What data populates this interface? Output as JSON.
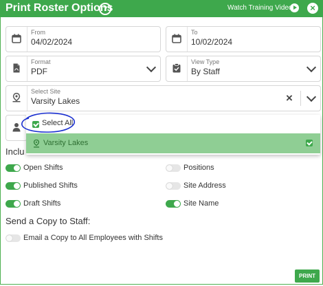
{
  "header": {
    "title": "Print Roster Options",
    "help_icon": "?",
    "watch_label": "Watch Training Video",
    "close_icon": "×",
    "color": "#3ea84c"
  },
  "fields": {
    "from": {
      "label": "From",
      "value": "04/02/2024",
      "icon": "calendar-icon"
    },
    "to": {
      "label": "To",
      "value": "10/02/2024",
      "icon": "calendar-icon"
    },
    "format": {
      "label": "Format",
      "value": "PDF",
      "icon": "pdf-file-icon"
    },
    "view_type": {
      "label": "View Type",
      "value": "By Staff",
      "icon": "clipboard-check-icon"
    },
    "site": {
      "label": "Select Site",
      "value": "Varsity Lakes",
      "icon": "map-pin-icon",
      "clear_icon": "×"
    }
  },
  "dropdown": {
    "select_all": "Select All",
    "items": [
      {
        "label": "Varsity Lakes",
        "selected": true,
        "highlight": "#8fce94"
      }
    ]
  },
  "include": {
    "title_visible": "Inclu",
    "left": [
      {
        "label": "Open Shifts",
        "on": true
      },
      {
        "label": "Published Shifts",
        "on": true
      },
      {
        "label": "Draft Shifts",
        "on": true
      }
    ],
    "right": [
      {
        "label": "Positions",
        "on": false
      },
      {
        "label": "Site Address",
        "on": false
      },
      {
        "label": "Site Name",
        "on": true
      }
    ]
  },
  "copy_section": {
    "title": "Send a Copy to Staff:",
    "option": {
      "label": "Email a Copy to All Employees with Shifts",
      "on": false
    }
  },
  "footer": {
    "print_label": "PRINT"
  }
}
